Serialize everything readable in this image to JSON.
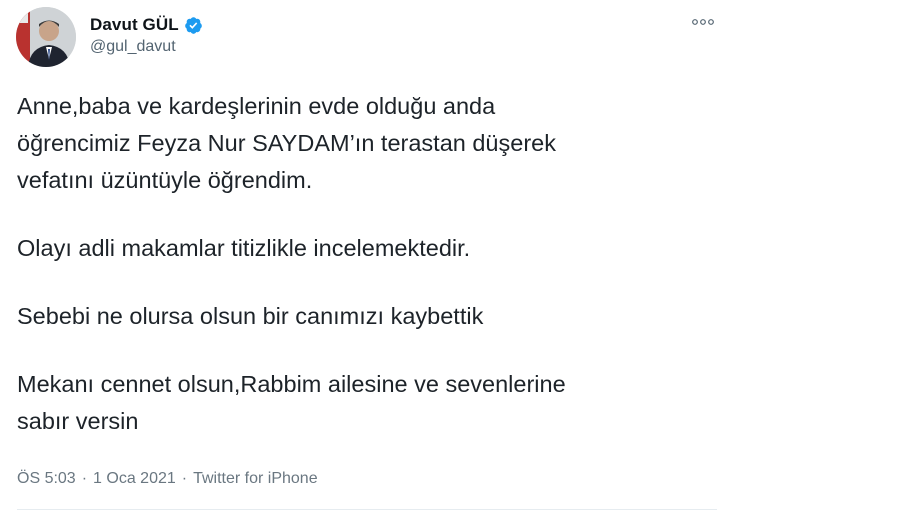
{
  "author": {
    "display_name": "Davut GÜL",
    "handle": "@gul_davut",
    "verified": true,
    "avatar_icon": "profile-photo"
  },
  "tweet": {
    "paragraphs": [
      {
        "lines": [
          "Anne,baba ve kardeşlerinin evde olduğu anda",
          "öğrencimiz Feyza Nur SAYDAM’ın terastan düşerek",
          "vefatını üzüntüyle öğrendim."
        ]
      },
      {
        "lines": [
          "Olayı adli makamlar titizlikle incelemektedir."
        ]
      },
      {
        "lines": [
          "Sebebi ne olursa olsun bir canımızı kaybettik"
        ]
      },
      {
        "lines": [
          "Mekanı cennet olsun,Rabbim ailesine ve sevenlerine",
          "sabır versin"
        ]
      }
    ]
  },
  "meta": {
    "time": "ÖS 5:03",
    "separator": "·",
    "date": "1 Oca 2021",
    "source": "Twitter for iPhone"
  },
  "colors": {
    "verified_badge": "#1d9bf0",
    "secondary_text": "#536471",
    "primary_text": "#0f1419"
  },
  "icons": {
    "more": "more-options-icon",
    "verified": "verified-badge-icon"
  }
}
